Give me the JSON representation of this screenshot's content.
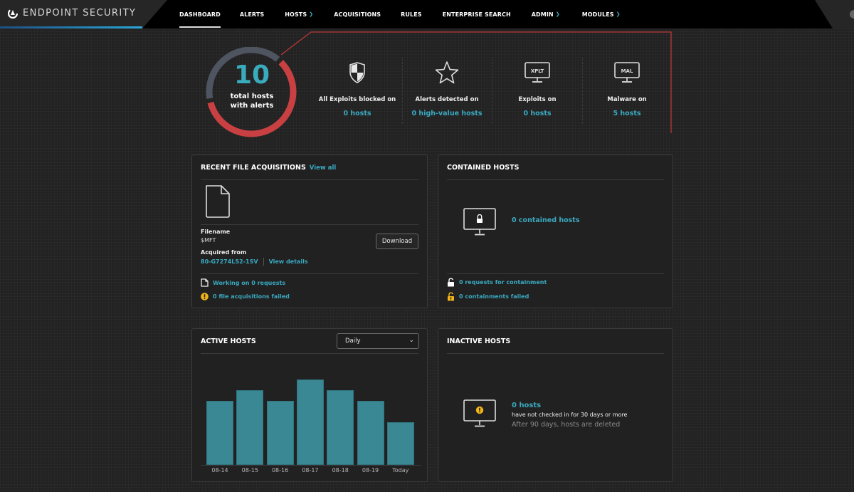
{
  "app": {
    "title": "ENDPOINT SECURITY",
    "accent": "#3aa9c0",
    "alert_color": "#c84042"
  },
  "nav": {
    "items": [
      {
        "label": "DASHBOARD",
        "active": true,
        "has_dropdown": false
      },
      {
        "label": "ALERTS",
        "active": false,
        "has_dropdown": false
      },
      {
        "label": "HOSTS",
        "active": false,
        "has_dropdown": true
      },
      {
        "label": "ACQUISITIONS",
        "active": false,
        "has_dropdown": false
      },
      {
        "label": "RULES",
        "active": false,
        "has_dropdown": false
      },
      {
        "label": "ENTERPRISE SEARCH",
        "active": false,
        "has_dropdown": false
      },
      {
        "label": "ADMIN",
        "active": false,
        "has_dropdown": true
      },
      {
        "label": "MODULES",
        "active": false,
        "has_dropdown": true
      }
    ],
    "dropdown_icon": "chevron-down-icon"
  },
  "summary": {
    "total_hosts": "10",
    "total_label_line1": "total hosts",
    "total_label_line2": "with alerts",
    "donut": {
      "alert_fraction": 0.6,
      "other_fraction": 0.4
    },
    "stats": [
      {
        "icon": "shield-icon",
        "label": "All Exploits blocked on",
        "value": "0  hosts"
      },
      {
        "icon": "star-icon",
        "label": "Alerts detected on",
        "value": "0  high-value hosts"
      },
      {
        "icon": "monitor-xplt-icon",
        "icon_text": "XPLT",
        "label": "Exploits on",
        "value": "0  hosts"
      },
      {
        "icon": "monitor-mal-icon",
        "icon_text": "MAL",
        "label": "Malware on",
        "value": "5  hosts"
      }
    ]
  },
  "acquisitions": {
    "title": "RECENT FILE ACQUISITIONS",
    "view_all": "View all",
    "filename_label": "Filename",
    "filename": "$MFT",
    "download_label": "Download",
    "acquired_from_label": "Acquired from",
    "host": "80-G7274LS2-1SV",
    "view_details": "View details",
    "working_status": "Working on 0 requests",
    "failed_status": "0 file acquisitions failed"
  },
  "contained": {
    "title": "CONTAINED HOSTS",
    "count_text": "0 contained hosts",
    "requests_text": "0 requests for containment",
    "failed_text": "0 containments failed"
  },
  "active_hosts": {
    "title": "ACTIVE HOSTS",
    "period_selected": "Daily"
  },
  "inactive": {
    "title": "INACTIVE HOSTS",
    "count_text": "0 hosts",
    "desc": "have not checked in for 30 days or more",
    "note": "After 90 days, hosts are deleted"
  },
  "chart_data": {
    "type": "bar",
    "title": "ACTIVE HOSTS",
    "categories": [
      "08-14",
      "08-15",
      "08-16",
      "08-17",
      "08-18",
      "08-19",
      "Today"
    ],
    "values": [
      6,
      7,
      6,
      8,
      7,
      6,
      4
    ],
    "xlabel": "",
    "ylabel": "",
    "ylim": [
      0,
      8
    ],
    "grid": false,
    "color": "#3a8893"
  }
}
